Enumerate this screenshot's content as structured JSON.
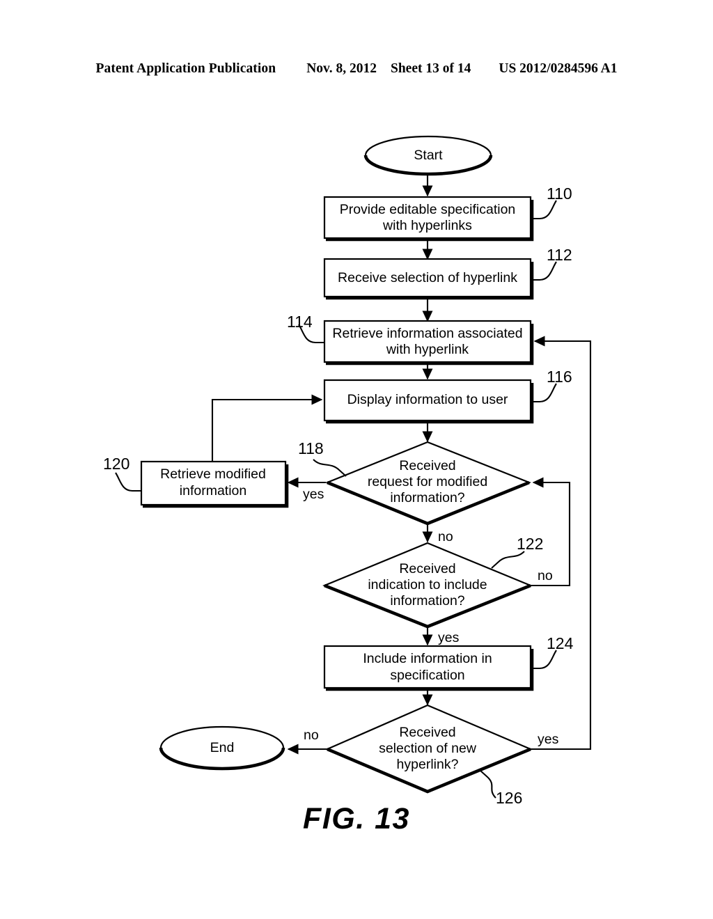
{
  "header": {
    "publication": "Patent Application Publication",
    "date": "Nov. 8, 2012",
    "sheet": "Sheet 13 of 14",
    "pub_number": "US 2012/0284596 A1"
  },
  "figure": {
    "caption": "FIG. 13"
  },
  "flowchart": {
    "nodes": [
      {
        "id": "start",
        "type": "terminator",
        "label": "Start",
        "ref": null
      },
      {
        "id": "n110",
        "type": "process",
        "label_line1": "Provide editable specification",
        "label_line2": "with hyperlinks",
        "ref": "110"
      },
      {
        "id": "n112",
        "type": "process",
        "label_line1": "Receive selection of hyperlink",
        "label_line2": "",
        "ref": "112"
      },
      {
        "id": "n114",
        "type": "process",
        "label_line1": "Retrieve information associated",
        "label_line2": "with hyperlink",
        "ref": "114"
      },
      {
        "id": "n116",
        "type": "process",
        "label_line1": "Display information to user",
        "label_line2": "",
        "ref": "116"
      },
      {
        "id": "n118",
        "type": "decision",
        "label_line1": "Received",
        "label_line2": "request for modified",
        "label_line3": "information?",
        "ref": "118"
      },
      {
        "id": "n120",
        "type": "process",
        "label_line1": "Retrieve modified",
        "label_line2": "information",
        "ref": "120"
      },
      {
        "id": "n122",
        "type": "decision",
        "label_line1": "Received",
        "label_line2": "indication to include",
        "label_line3": "information?",
        "ref": "122"
      },
      {
        "id": "n124",
        "type": "process",
        "label_line1": "Include information in",
        "label_line2": "specification",
        "ref": "124"
      },
      {
        "id": "n126",
        "type": "decision",
        "label_line1": "Received",
        "label_line2": "selection of new",
        "label_line3": "hyperlink?",
        "ref": "126"
      },
      {
        "id": "end",
        "type": "terminator",
        "label": "End",
        "ref": null
      }
    ],
    "edge_labels": {
      "e118_yes": "yes",
      "e118_no": "no",
      "e122_no": "no",
      "e122_yes": "yes",
      "e126_no": "no",
      "e126_yes": "yes"
    },
    "ref_numbers": {
      "r110": "110",
      "r112": "112",
      "r114": "114",
      "r116": "116",
      "r118": "118",
      "r120": "120",
      "r122": "122",
      "r124": "124",
      "r126": "126"
    }
  },
  "colors": {
    "ink": "#000000",
    "paper": "#ffffff"
  }
}
